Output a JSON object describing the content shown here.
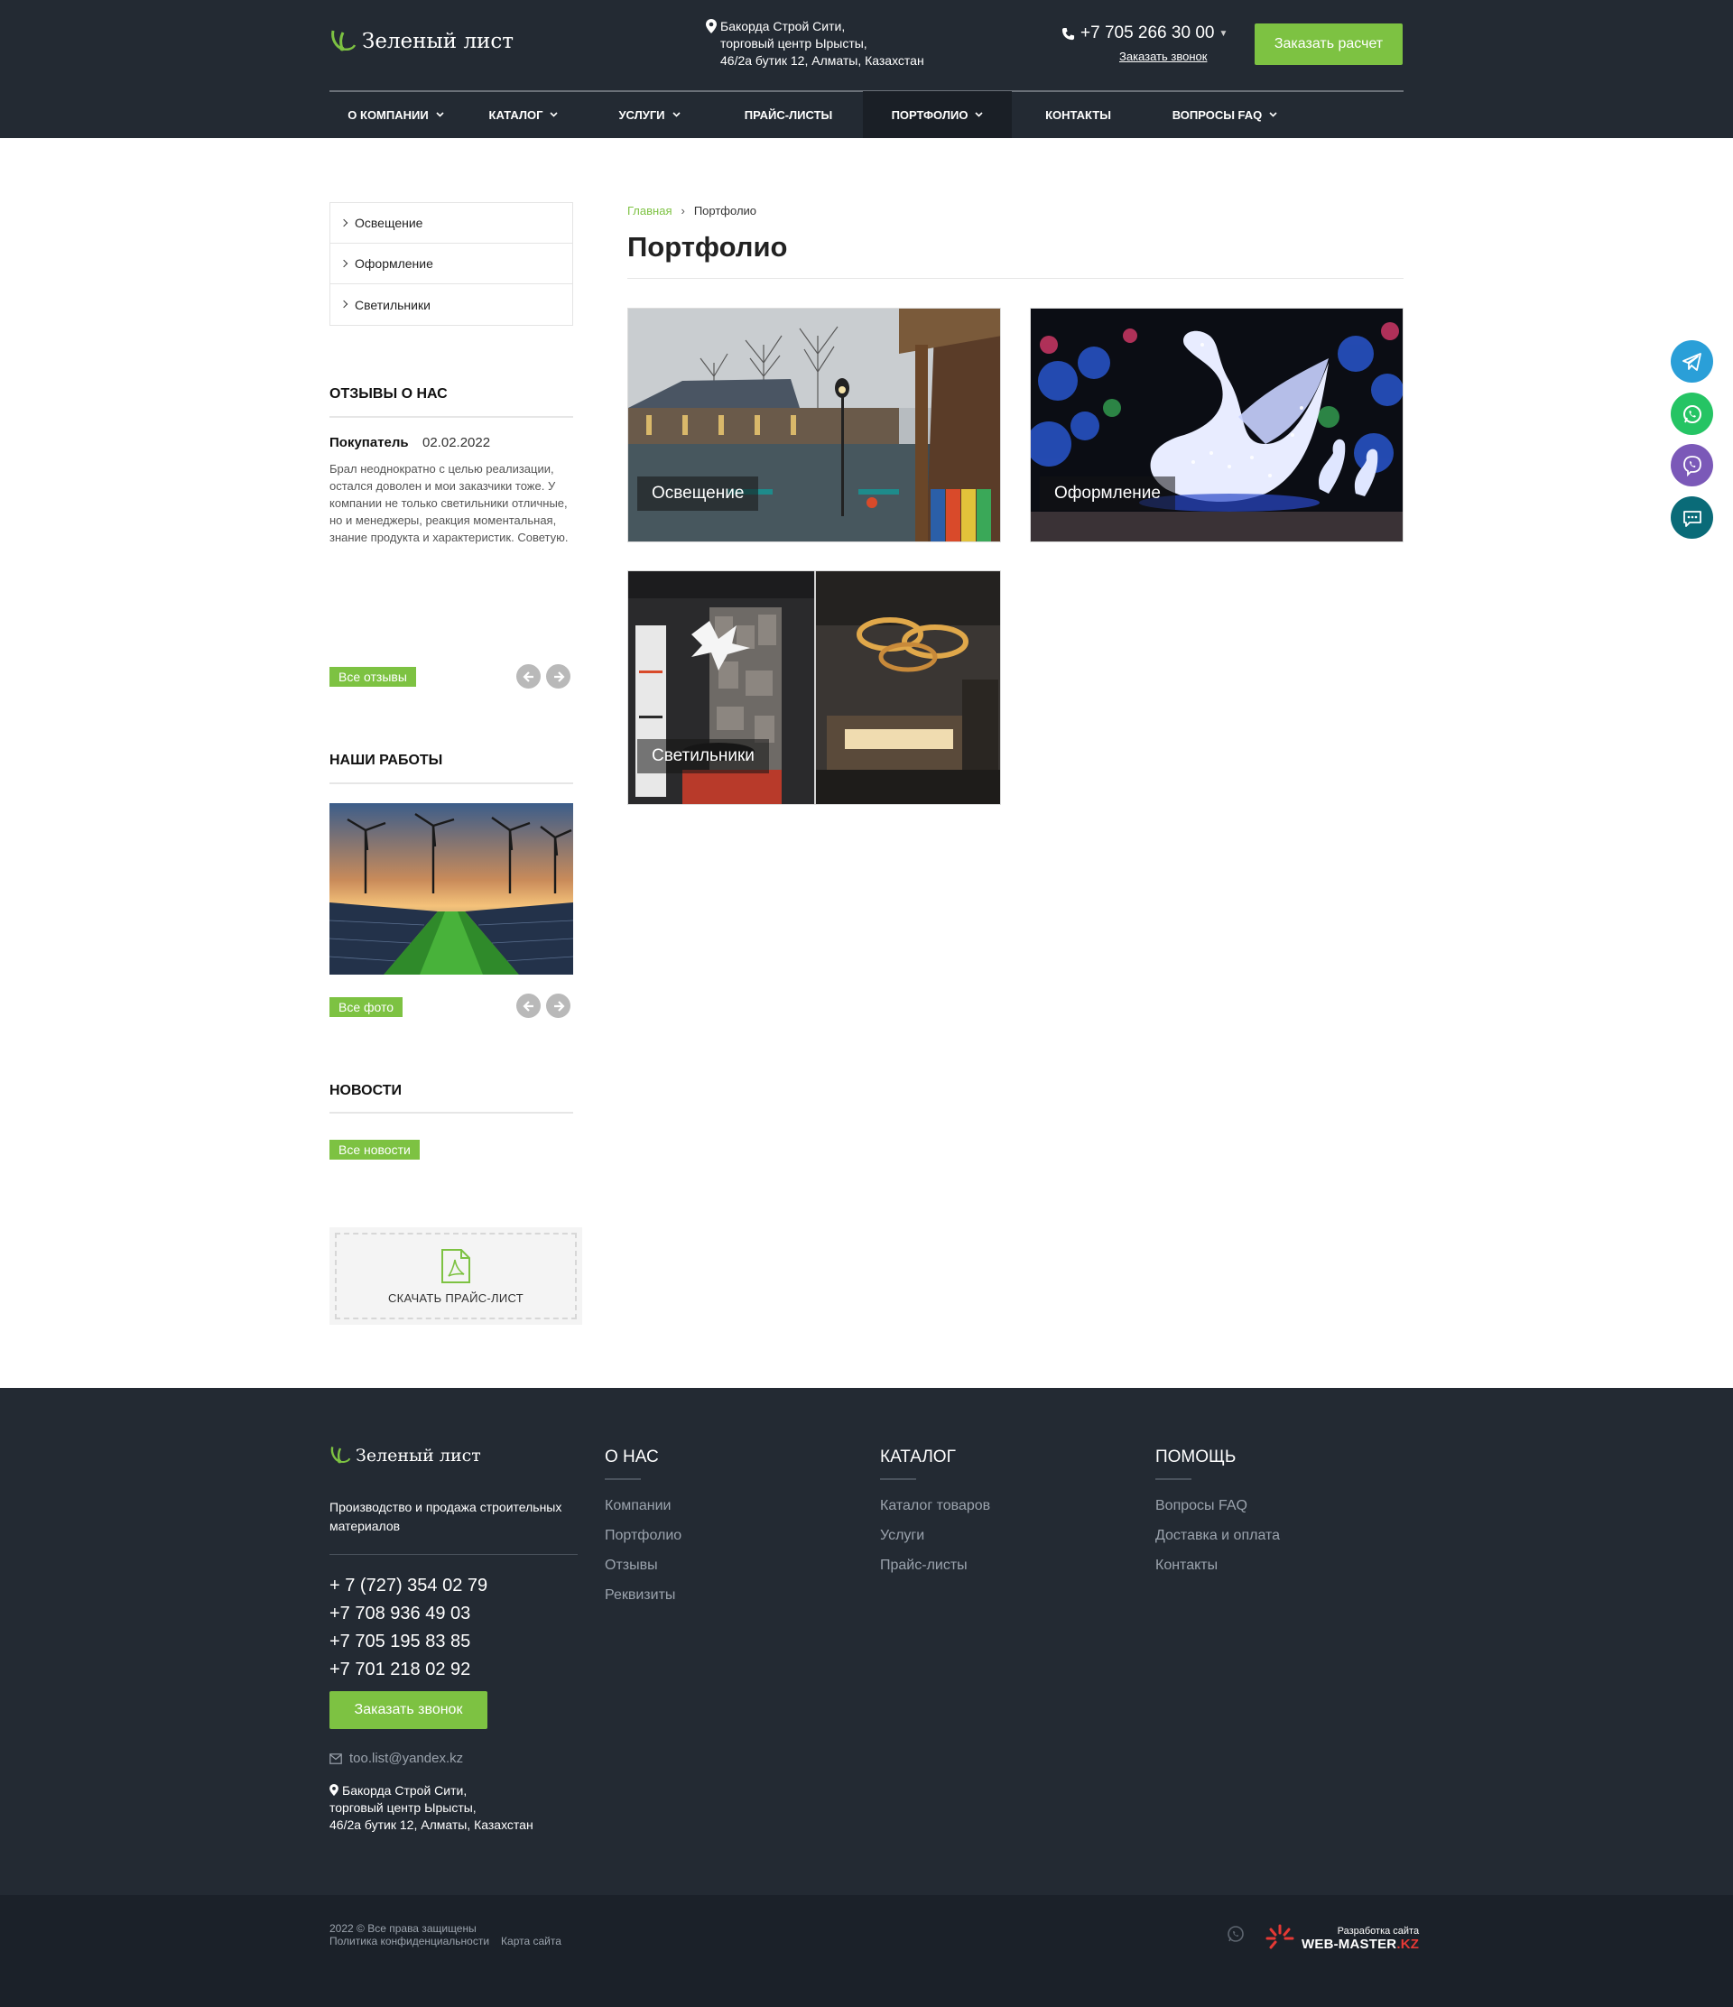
{
  "header": {
    "logo_text": "Зеленый лист",
    "address_line1": "Бакорда Строй Сити,",
    "address_line2": "торговый центр Ырысты,",
    "address_line3": "46/2а бутик 12, Алматы, Казахстан",
    "phone": "+7 705 266 30 00",
    "callback_link": "Заказать звонок",
    "order_button": "Заказать расчет"
  },
  "nav": {
    "items": [
      {
        "label": "О компании",
        "has_dropdown": true
      },
      {
        "label": "Каталог",
        "has_dropdown": true
      },
      {
        "label": "Услуги",
        "has_dropdown": true
      },
      {
        "label": "Прайс-листы",
        "has_dropdown": false
      },
      {
        "label": "Портфолио",
        "has_dropdown": true,
        "active": true
      },
      {
        "label": "Контакты",
        "has_dropdown": false
      },
      {
        "label": "Вопросы FAQ",
        "has_dropdown": true
      }
    ]
  },
  "sidebar": {
    "menu": [
      "Освещение",
      "Оформление",
      "Светильники"
    ],
    "reviews": {
      "title": "Отзывы о нас",
      "author": "Покупатель",
      "date": "02.02.2022",
      "text": "Брал неоднократно с целью реализации, остался доволен и мои заказчики тоже. У компании не только светильники отличные, но и менеджеры, реакция моментальная, знание продукта и характеристик. Советую.",
      "all_link": "Все отзывы"
    },
    "works": {
      "title": "Наши работы",
      "all_link": "Все фото"
    },
    "news": {
      "title": "Новости",
      "all_link": "Все новости"
    },
    "pricelist": "Скачать прайс-лист"
  },
  "main": {
    "breadcrumb_home": "Главная",
    "breadcrumb_sep": "›",
    "breadcrumb_current": "Портфолио",
    "title": "Портфолио",
    "tiles": [
      "Освещение",
      "Оформление",
      "Светильники"
    ]
  },
  "footer": {
    "logo_text": "Зеленый лист",
    "description": "Производство и продажа строительных материалов",
    "phones": [
      "+ 7 (727) 354 02 79",
      "+7 708 936 49 03",
      "+7 705 195 83 85",
      "+7 701 218 02 92"
    ],
    "callback_button": "Заказать звонок",
    "email": "too.list@yandex.kz",
    "address_line1": "Бакорда Строй Сити,",
    "address_line2": "торговый центр Ырысты,",
    "address_line3": "46/2а бутик 12, Алматы, Казахстан",
    "col_about": {
      "title": "О нас",
      "links": [
        "Компании",
        "Портфолио",
        "Отзывы",
        "Реквизиты"
      ]
    },
    "col_catalog": {
      "title": "Каталог",
      "links": [
        "Каталог товаров",
        "Услуги",
        "Прайс-листы"
      ]
    },
    "col_help": {
      "title": "Помощь",
      "links": [
        "Вопросы FAQ",
        "Доставка и оплата",
        "Контакты"
      ]
    },
    "copyright": "2022 © Все права защищены",
    "privacy": "Политика конфиденциальности",
    "sitemap": "Карта сайта",
    "dev_small": "Разработка сайта",
    "dev_brand": "WEB-MASTER",
    "dev_brand_tld": ".KZ"
  },
  "colors": {
    "accent": "#7dc242",
    "header_bg": "#232a33",
    "telegram": "#2a9fd8",
    "whatsapp": "#25c464",
    "viber": "#7b59b8",
    "chat": "#0a6b78"
  },
  "icons": [
    "leaf-logo-icon",
    "map-pin-icon",
    "phone-icon",
    "chevron-down-icon",
    "telegram-icon",
    "whatsapp-icon",
    "viber-icon",
    "chat-icon",
    "pdf-icon",
    "mail-icon",
    "arrow-left-icon",
    "arrow-right-icon"
  ]
}
